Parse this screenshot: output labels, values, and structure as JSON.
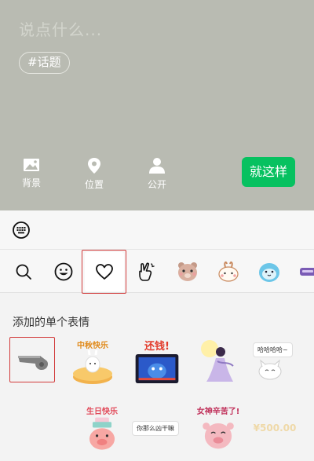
{
  "compose": {
    "placeholder": "说点什么...",
    "topic_chip": "#话题",
    "options": [
      {
        "label": "背景",
        "icon": "image-icon"
      },
      {
        "label": "位置",
        "icon": "location-pin-icon"
      },
      {
        "label": "公开",
        "icon": "person-icon"
      }
    ],
    "submit_label": "就这样",
    "submit_color": "#07c160",
    "background_color": "#b9bbb2"
  },
  "emoji_panel": {
    "tabs": [
      {
        "icon": "search-icon"
      },
      {
        "icon": "smiley-icon"
      },
      {
        "icon": "heart-icon",
        "active": true
      },
      {
        "icon": "victory-hand-icon"
      },
      {
        "icon": "bear-sticker-icon"
      },
      {
        "icon": "bunny-sticker-icon"
      },
      {
        "icon": "blue-blob-sticker-icon"
      },
      {
        "icon": "purple-sticker-icon"
      }
    ],
    "section_title": "添加的单个表情",
    "stickers": [
      {
        "name": "whistle-sticker"
      },
      {
        "name": "mid-autumn-bunny-sticker",
        "text": "中秋快乐"
      },
      {
        "name": "pay-back-tv-sticker",
        "text": "还钱!"
      },
      {
        "name": "moon-fairy-sticker"
      },
      {
        "name": "laugh-cat-sticker",
        "text": "哈哈哈哈~"
      },
      {
        "name": "birthday-pig-sticker",
        "text": "生日快乐"
      },
      {
        "name": "what-are-you-doing-sticker",
        "text": "你那么凶干嘛"
      },
      {
        "name": "goddess-tired-sticker",
        "text": "女神辛苦了!"
      },
      {
        "name": "faded-text-sticker",
        "text": "¥500.00"
      }
    ]
  }
}
